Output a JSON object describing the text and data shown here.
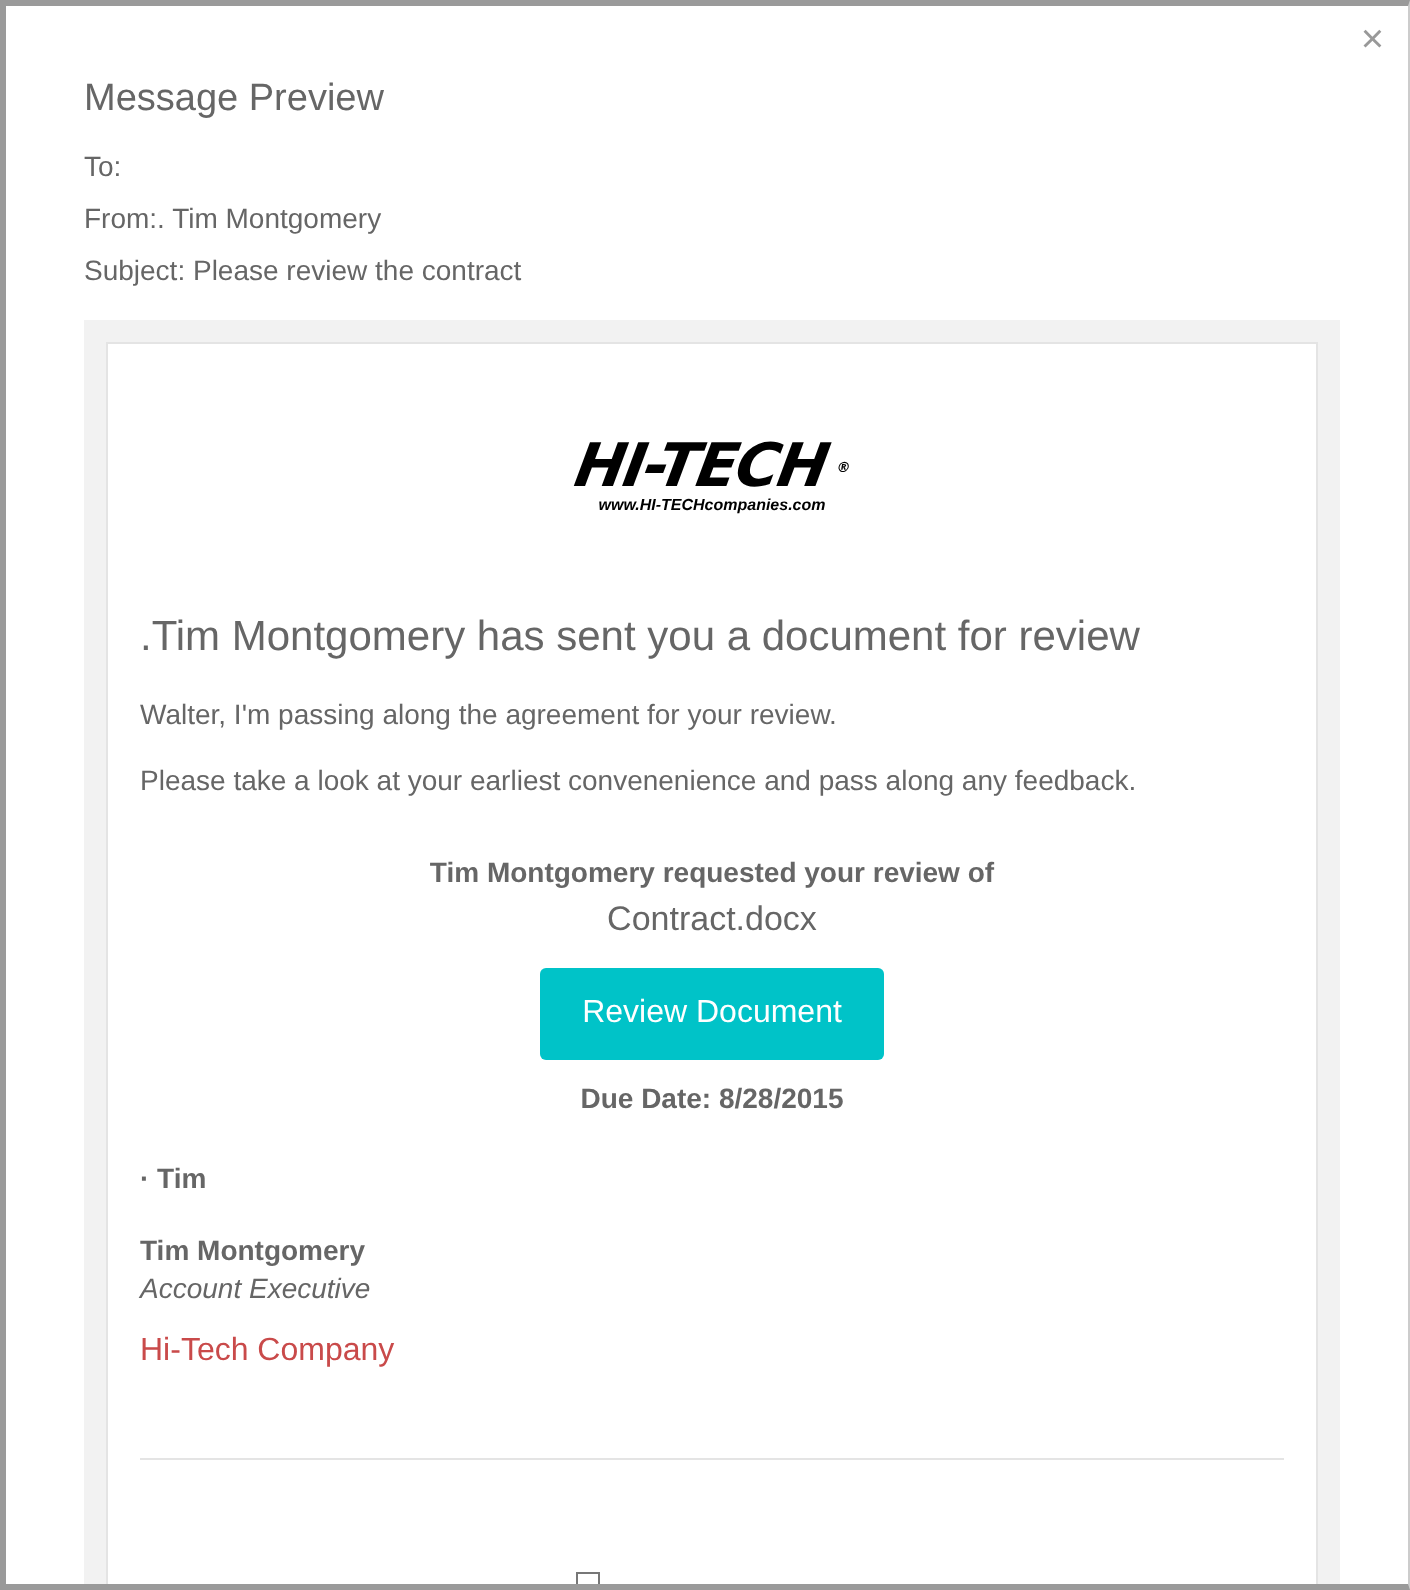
{
  "dialog": {
    "title": "Message Preview",
    "close": "×"
  },
  "headers": [
    {
      "label": "To:"
    },
    {
      "label": "From:.",
      "value": "Tim Montgomery"
    },
    {
      "label": "Subject:",
      "value": "Please review the contract"
    }
  ],
  "email": {
    "logo": {
      "name": "HI-TECH",
      "mark": "®",
      "url": "www.HI-TECHcompanies.com"
    },
    "heading": ".Tim Montgomery has sent you a document for review",
    "paragraphs": [
      "Walter, I'm passing along the agreement for your review.",
      "Please take a look at your earliest convenenience and pass along any feedback."
    ],
    "request": "Tim Montgomery requested your review of",
    "document": "Contract.docx",
    "button": "Review Document",
    "due": "Due Date: 8/28/2015",
    "signoff": "· Tim",
    "signature": {
      "name": "Tim Montgomery",
      "role": "Account Executive",
      "company": "Hi-Tech Company"
    }
  }
}
